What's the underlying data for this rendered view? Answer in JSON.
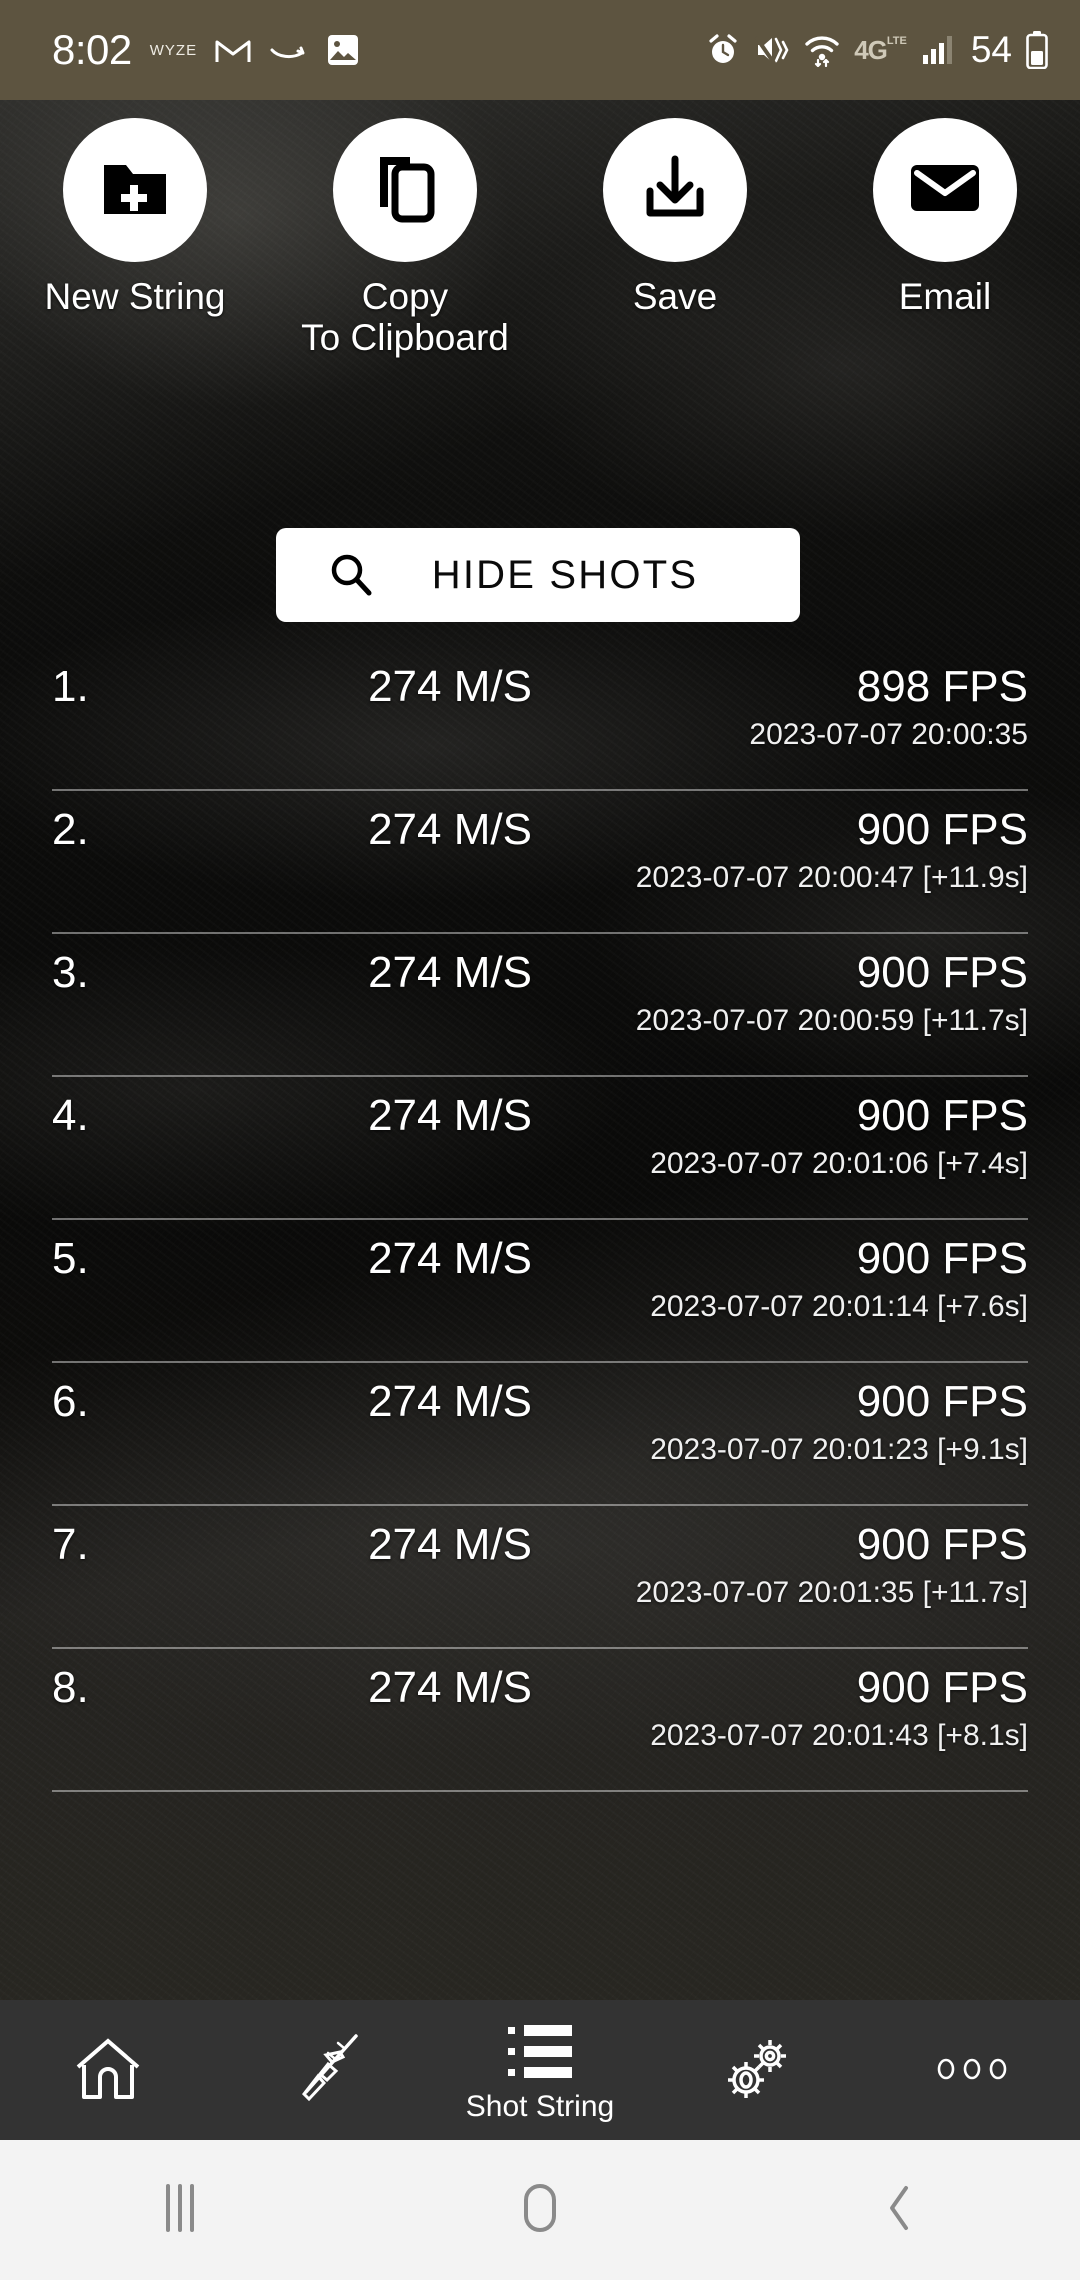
{
  "status_bar": {
    "clock": "8:02",
    "wyze_label": "WYZE",
    "battery_percent": "54",
    "network_label": "4G",
    "network_sub": "LTE",
    "background_color": "#5d5440",
    "icons": [
      "wyze-icon",
      "gmail-icon",
      "amazon-icon",
      "photos-icon",
      "alarm-icon",
      "vibrate-mute-icon",
      "wifi-icon",
      "signal-icon",
      "battery-icon"
    ]
  },
  "actions": [
    {
      "label": "New String",
      "icon": "new-folder-icon"
    },
    {
      "label": "Copy\nTo Clipboard",
      "icon": "copy-icon"
    },
    {
      "label": "Save",
      "icon": "download-icon"
    },
    {
      "label": "Email",
      "icon": "envelope-icon"
    }
  ],
  "hide_shots": {
    "label": "HIDE SHOTS",
    "icon": "search-icon"
  },
  "shots": [
    {
      "index": "1.",
      "speed": "274 M/S",
      "fps": "898 FPS",
      "time": "2023-07-07 20:00:35"
    },
    {
      "index": "2.",
      "speed": "274 M/S",
      "fps": "900 FPS",
      "time": "2023-07-07 20:00:47 [+11.9s]"
    },
    {
      "index": "3.",
      "speed": "274 M/S",
      "fps": "900 FPS",
      "time": "2023-07-07 20:00:59 [+11.7s]"
    },
    {
      "index": "4.",
      "speed": "274 M/S",
      "fps": "900 FPS",
      "time": "2023-07-07 20:01:06 [+7.4s]"
    },
    {
      "index": "5.",
      "speed": "274 M/S",
      "fps": "900 FPS",
      "time": "2023-07-07 20:01:14 [+7.6s]"
    },
    {
      "index": "6.",
      "speed": "274 M/S",
      "fps": "900 FPS",
      "time": "2023-07-07 20:01:23 [+9.1s]"
    },
    {
      "index": "7.",
      "speed": "274 M/S",
      "fps": "900 FPS",
      "time": "2023-07-07 20:01:35 [+11.7s]"
    },
    {
      "index": "8.",
      "speed": "274 M/S",
      "fps": "900 FPS",
      "time": "2023-07-07 20:01:43 [+8.1s]"
    }
  ],
  "bottom_nav": {
    "background_color": "#333333",
    "items": [
      {
        "name": "home",
        "icon": "home-icon",
        "label": ""
      },
      {
        "name": "rifle",
        "icon": "rifle-icon",
        "label": ""
      },
      {
        "name": "shot-string",
        "icon": "list-icon",
        "label": "Shot String"
      },
      {
        "name": "settings",
        "icon": "gears-icon",
        "label": ""
      },
      {
        "name": "more",
        "icon": "more-dots-icon",
        "label": ""
      }
    ]
  },
  "android_nav": {
    "background_color": "#f3f3f3",
    "items": [
      "recents-icon",
      "home-circle-icon",
      "back-icon"
    ]
  }
}
